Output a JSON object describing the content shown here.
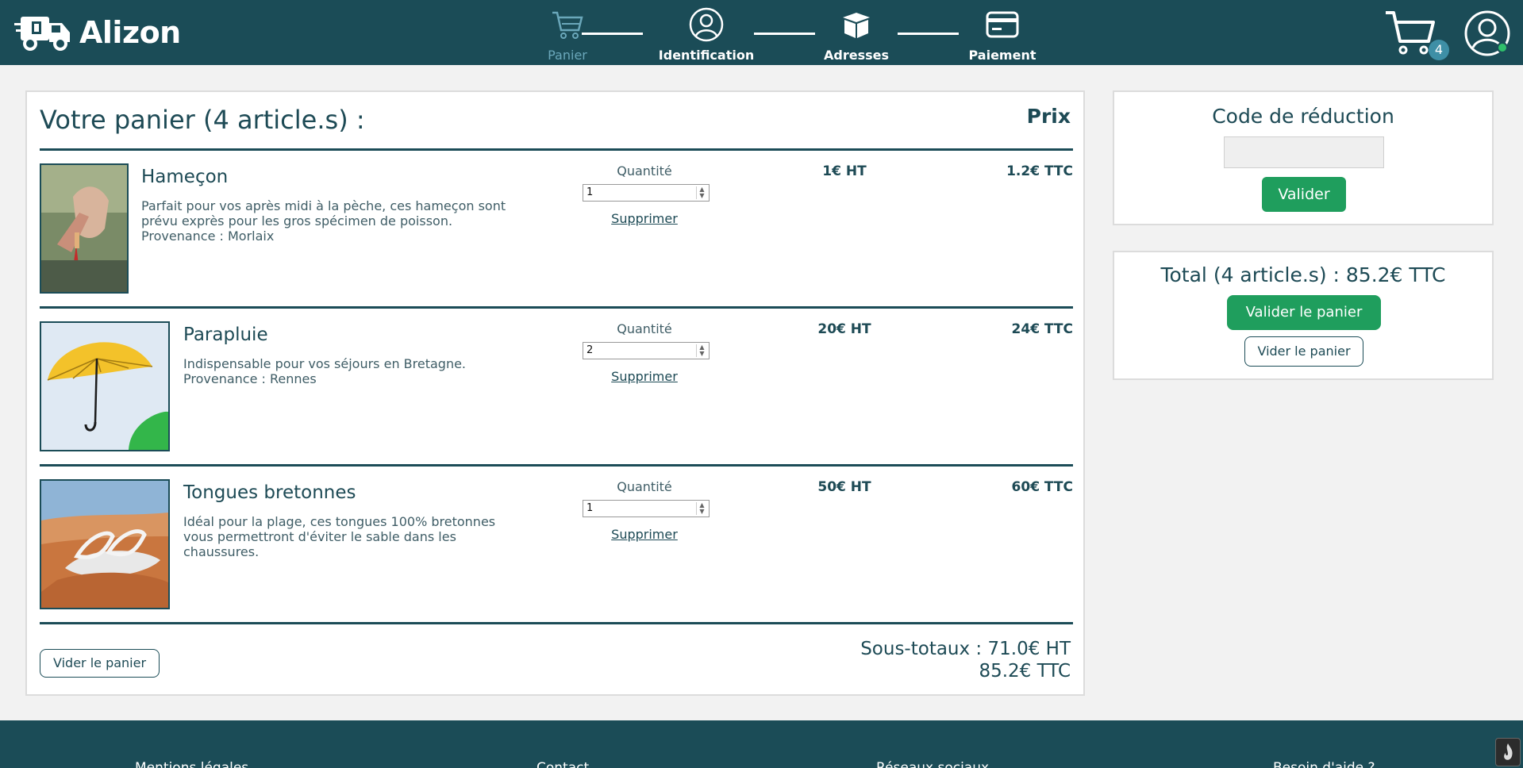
{
  "header": {
    "brand": "Alizon",
    "steps": [
      {
        "label": "Panier",
        "icon": "cart-icon",
        "active": true
      },
      {
        "label": "Identification",
        "icon": "user-circle-icon",
        "active": false
      },
      {
        "label": "Adresses",
        "icon": "box-icon",
        "active": false
      },
      {
        "label": "Paiement",
        "icon": "credit-card-icon",
        "active": false
      }
    ],
    "cart_count": "4"
  },
  "cart": {
    "title": "Votre panier (4 article.s) :",
    "price_heading": "Prix",
    "items": [
      {
        "name": "Hameçon",
        "description": "Parfait pour vos après midi à la pèche, ces hameçon sont prévu exprès pour les gros spécimen de poisson.",
        "origin": "Provenance : Morlaix",
        "quantity_label": "Quantité",
        "quantity": "1",
        "remove_label": "Supprimer",
        "price_ht": "1€ HT",
        "price_ttc": "1.2€ TTC"
      },
      {
        "name": "Parapluie",
        "description": "Indispensable pour vos séjours en Bretagne.",
        "origin": "Provenance : Rennes",
        "quantity_label": "Quantité",
        "quantity": "2",
        "remove_label": "Supprimer",
        "price_ht": "20€ HT",
        "price_ttc": "24€ TTC"
      },
      {
        "name": "Tongues bretonnes",
        "description": "Idéal pour la plage, ces tongues 100% bretonnes vous permettront d'éviter le sable dans les chaussures.",
        "origin": "",
        "quantity_label": "Quantité",
        "quantity": "1",
        "remove_label": "Supprimer",
        "price_ht": "50€ HT",
        "price_ttc": "60€ TTC"
      }
    ],
    "empty_label": "Vider le panier",
    "subtotal_ht": "Sous-totaux : 71.0€ HT",
    "subtotal_ttc": "85.2€ TTC"
  },
  "discount": {
    "title": "Code de réduction",
    "input_value": "",
    "submit_label": "Valider"
  },
  "summary": {
    "total": "Total (4 article.s) : 85.2€ TTC",
    "validate_label": "Valider le panier",
    "clear_label": "Vider le panier"
  },
  "footer": {
    "links": [
      "Mentions légales",
      "Contact",
      "Réseaux sociaux",
      "Besoin d'aide ?"
    ]
  },
  "colors": {
    "brand": "#1b4c57",
    "accent_green": "#1f9e5d",
    "badge": "#3e8fa6",
    "active_step": "#6aa7ba"
  }
}
